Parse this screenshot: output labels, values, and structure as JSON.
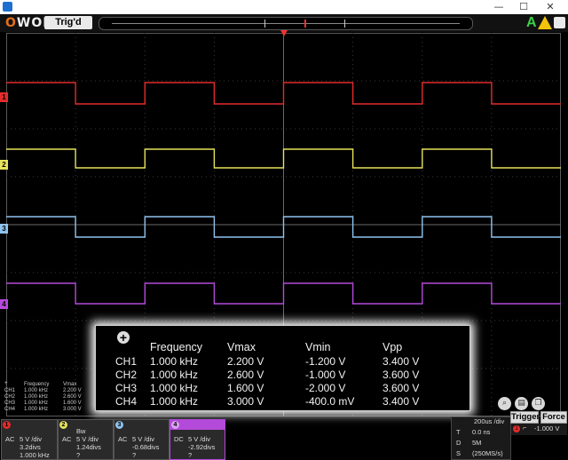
{
  "window": {
    "logo_prefix": "O",
    "logo_suffix": "WON",
    "minimize": "—",
    "maximize": "☐",
    "close": "✕"
  },
  "toolbar": {
    "trigger_status": "Trig'd",
    "run_icon": "run-arrow-icon",
    "warning_icon": "warning-icon",
    "home_icon": "home-icon"
  },
  "colors": {
    "ch1": "#e32b2b",
    "ch2": "#e6e25a",
    "ch3": "#8fc3ef",
    "ch4": "#b44ad9",
    "grid": "#3a3a3a"
  },
  "channel_markers": [
    "1",
    "2",
    "3",
    "4"
  ],
  "waveform": {
    "period_divs": 2,
    "first_rise_div": 2
  },
  "measurements": {
    "headers": [
      "Frequency",
      "Vmax",
      "Vmin",
      "Vpp"
    ],
    "rows": [
      {
        "ch": "CH1",
        "frequency": "1.000 kHz",
        "vmax": "2.200 V",
        "vmin": "-1.200 V",
        "vpp": "3.400 V"
      },
      {
        "ch": "CH2",
        "frequency": "1.000 kHz",
        "vmax": "2.600 V",
        "vmin": "-1.000 V",
        "vpp": "3.600 V"
      },
      {
        "ch": "CH3",
        "frequency": "1.000 kHz",
        "vmax": "1.600 V",
        "vmin": "-2.000 V",
        "vpp": "3.600 V"
      },
      {
        "ch": "CH4",
        "frequency": "1.000 kHz",
        "vmax": "3.000 V",
        "vmin": "-400.0 mV",
        "vpp": "3.400 V"
      }
    ]
  },
  "mini_measurements": {
    "headers": [
      "Frequency",
      "Vmax"
    ],
    "rows": [
      {
        "ch": "CH1",
        "frequency": "1.000 kHz",
        "vmax": "2.200 V"
      },
      {
        "ch": "CH2",
        "frequency": "1.000 kHz",
        "vmax": "2.600 V"
      },
      {
        "ch": "CH3",
        "frequency": "1.000 kHz",
        "vmax": "1.600 V"
      },
      {
        "ch": "CH4",
        "frequency": "1.000 kHz",
        "vmax": "3.000 V"
      }
    ]
  },
  "channels": [
    {
      "num": "1",
      "coupling": "AC",
      "scale": "5 V /div",
      "pos": "3.2divs",
      "extra": "1.000 kHz",
      "bw": ""
    },
    {
      "num": "2",
      "coupling": "AC",
      "scale": "5 V /div",
      "pos": "1.24divs",
      "extra": "?",
      "bw": "Bw"
    },
    {
      "num": "3",
      "coupling": "AC",
      "scale": "5 V /div",
      "pos": "-0.68divs",
      "extra": "?",
      "bw": ""
    },
    {
      "num": "4",
      "coupling": "DC",
      "scale": "5 V /div",
      "pos": "-2.92divs",
      "extra": "?",
      "bw": ""
    }
  ],
  "timebase": {
    "scale": "200us /div",
    "t_label": "T",
    "t_value": "0.0 ns",
    "d_label": "D",
    "d_value": "5M",
    "s_label": "S",
    "s_value": "(250MS/s)"
  },
  "buttons": {
    "trigger": "Trigger",
    "force": "Force"
  },
  "trigger_info": {
    "source": "1",
    "level": "-1.000 V"
  },
  "tools": [
    "zoom-icon",
    "save-icon",
    "copy-icon"
  ]
}
